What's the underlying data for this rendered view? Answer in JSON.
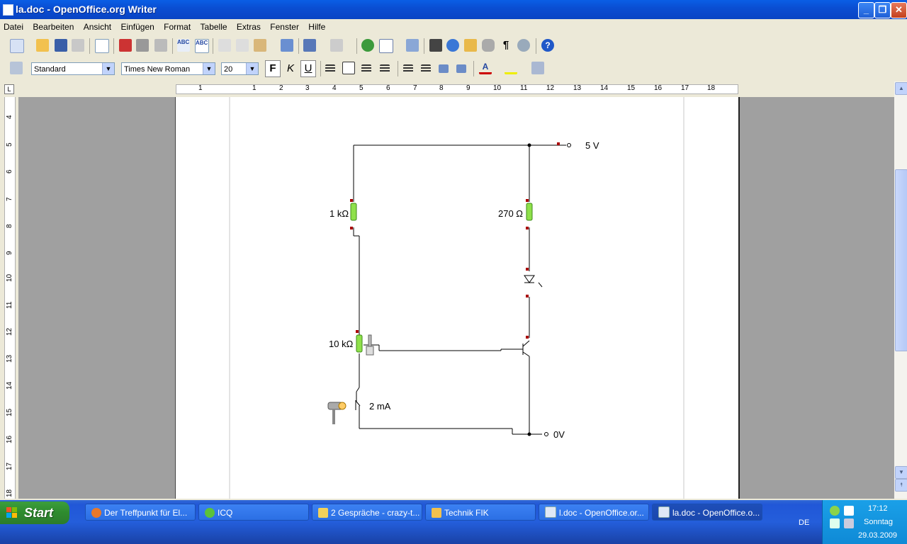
{
  "window": {
    "title": "la.doc - OpenOffice.org Writer"
  },
  "menu": [
    "Datei",
    "Bearbeiten",
    "Ansicht",
    "Einfügen",
    "Format",
    "Tabelle",
    "Extras",
    "Fenster",
    "Hilfe"
  ],
  "formatting": {
    "style": "Standard",
    "font": "Times New Roman",
    "size": "20",
    "bold_label": "F",
    "italic_label": "K",
    "underline_label": "U"
  },
  "ruler": {
    "h_ticks": [
      "1",
      "1",
      "2",
      "3",
      "4",
      "5",
      "6",
      "7",
      "8",
      "9",
      "10",
      "11",
      "12",
      "13",
      "14",
      "15",
      "16",
      "17",
      "18"
    ],
    "v_ticks": [
      "4",
      "5",
      "6",
      "7",
      "8",
      "9",
      "10",
      "11",
      "12",
      "13",
      "14",
      "15",
      "16",
      "17",
      "18"
    ]
  },
  "circuit": {
    "supply_label": "5 V",
    "ground_label": "0V",
    "r1_label": "1 kΩ",
    "r2_label": "270 Ω",
    "pot_label": "10 kΩ",
    "current_label": "2 mA"
  },
  "taskbar": {
    "start_label": "Start",
    "tasks": [
      {
        "label": "Der Treffpunkt für El...",
        "icon": "firefox-icon"
      },
      {
        "label": "ICQ",
        "icon": "icq-icon"
      },
      {
        "label": "2 Gespräche - crazy-t...",
        "icon": "chat-icon"
      },
      {
        "label": "Technik FIK",
        "icon": "folder-icon"
      },
      {
        "label": "l.doc - OpenOffice.or...",
        "icon": "writer-icon"
      },
      {
        "label": "la.doc - OpenOffice.o...",
        "icon": "writer-icon"
      }
    ],
    "language": "DE",
    "time": "17:12",
    "day": "Sonntag",
    "date": "29.03.2009"
  }
}
